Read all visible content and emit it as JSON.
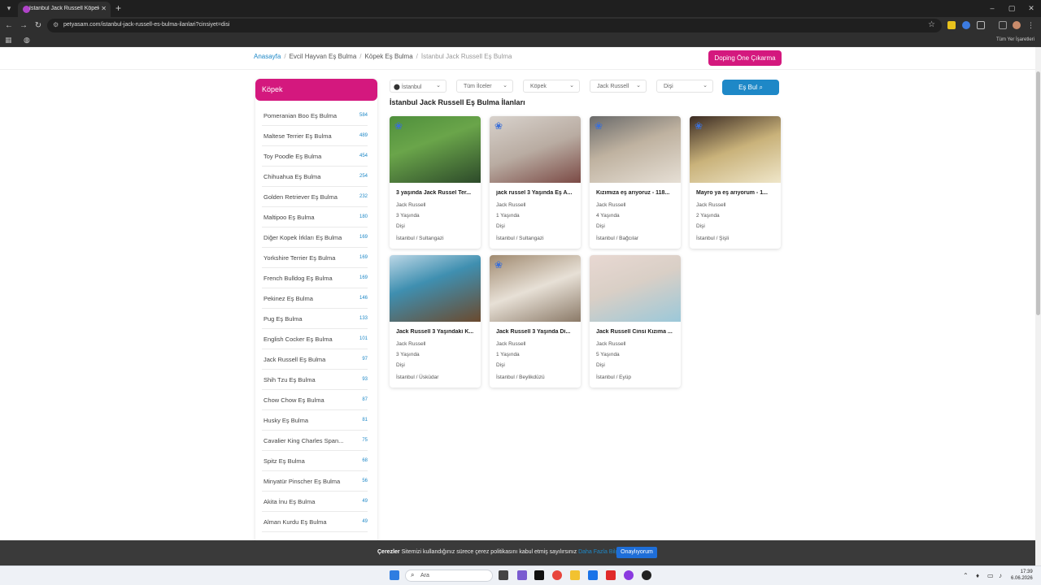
{
  "browser": {
    "tab_title": "İstanbul Jack Russell Köpek Eş Bulma",
    "url": "petyasam.com/istanbul-jack-russell-es-bulma-ilanlari?cinsiyet=disi",
    "bookmarks_all": "Tüm Yer İşaretleri",
    "window": {
      "minimize": "–",
      "maximize": "▢",
      "close": "✕"
    }
  },
  "breadcrumb": {
    "home": "Anasayfa",
    "pets": "Evcil Hayvan Eş Bulma",
    "dog": "Köpek Eş Bulma",
    "current": "İstanbul Jack Russell Eş Bulma",
    "sep": "/"
  },
  "doping_button": "Doping Öne Çıkarma",
  "sidebar": {
    "title": "Köpek",
    "items": [
      {
        "label": "Pomeranian Boo Eş Bulma",
        "count": "584"
      },
      {
        "label": "Maltese Terrier Eş Bulma",
        "count": "489"
      },
      {
        "label": "Toy Poodle Eş Bulma",
        "count": "454"
      },
      {
        "label": "Chihuahua Eş Bulma",
        "count": "254"
      },
      {
        "label": "Golden Retriever Eş Bulma",
        "count": "232"
      },
      {
        "label": "Maltipoo Eş Bulma",
        "count": "180"
      },
      {
        "label": "Diğer Kopek İrkları Eş Bulma",
        "count": "169"
      },
      {
        "label": "Yorkshire Terrier Eş Bulma",
        "count": "169"
      },
      {
        "label": "French Bulldog Eş Bulma",
        "count": "169"
      },
      {
        "label": "Pekinez Eş Bulma",
        "count": "146"
      },
      {
        "label": "Pug Eş Bulma",
        "count": "133"
      },
      {
        "label": "English Cocker Eş Bulma",
        "count": "101"
      },
      {
        "label": "Jack Russell Eş Bulma",
        "count": "97"
      },
      {
        "label": "Shih Tzu Eş Bulma",
        "count": "93"
      },
      {
        "label": "Chow Chow Eş Bulma",
        "count": "87"
      },
      {
        "label": "Husky Eş Bulma",
        "count": "81"
      },
      {
        "label": "Cavalier King Charles Span...",
        "count": "75"
      },
      {
        "label": "Spitz Eş Bulma",
        "count": "68"
      },
      {
        "label": "Minyatür Pinscher Eş Bulma",
        "count": "56"
      },
      {
        "label": "Akita İnu Eş Bulma",
        "count": "49"
      },
      {
        "label": "Alman Kurdu Eş Bulma",
        "count": "49"
      }
    ]
  },
  "filters": {
    "city": "İstanbul",
    "district": "Tüm İlceler",
    "species": "Köpek",
    "breed": "Jack Russell",
    "gender": "Dişi",
    "search_button": "Eş Bul"
  },
  "results_title": "İstanbul Jack Russell Eş Bulma İlanları",
  "listings": [
    {
      "title": "3 yaşında Jack Russel Ter...",
      "breed": "Jack Russell",
      "age": "3 Yaşında",
      "gender": "Dişi",
      "location": "İstanbul / Sultangazi",
      "paw": true
    },
    {
      "title": "jack russel 3 Yaşında Eş A...",
      "breed": "Jack Russell",
      "age": "1 Yaşında",
      "gender": "Dişi",
      "location": "İstanbul / Sultangazi",
      "paw": true
    },
    {
      "title": "Kızımıza eş arıyoruz - 118...",
      "breed": "Jack Russell",
      "age": "4 Yaşında",
      "gender": "Dişi",
      "location": "İstanbul / Bağcılar",
      "paw": true
    },
    {
      "title": "Mayro ya eş arıyorum - 1...",
      "breed": "Jack Russell",
      "age": "2 Yaşında",
      "gender": "Dişi",
      "location": "İstanbul / Şişli",
      "paw": true
    },
    {
      "title": "Jack Russell 3 Yaşındaki K...",
      "breed": "Jack Russell",
      "age": "3 Yaşında",
      "gender": "Dişi",
      "location": "İstanbul / Üsküdar",
      "paw": false
    },
    {
      "title": "Jack Russell 3 Yaşında Di...",
      "breed": "Jack Russell",
      "age": "1 Yaşında",
      "gender": "Dişi",
      "location": "İstanbul / Beylikdüzü",
      "paw": true
    },
    {
      "title": "Jack Russell Cinsi Kızıma ...",
      "breed": "Jack Russell",
      "age": "5 Yaşında",
      "gender": "Dişi",
      "location": "İstanbul / Eyüp",
      "paw": false
    }
  ],
  "cookie": {
    "label": "Çerezler",
    "text": "Sitemizi kullandığınız sürece çerez politikasını kabul etmiş sayılırsınız",
    "link": "Daha Fazla Bilgi",
    "button": "Onaylıyorum"
  },
  "taskbar": {
    "search_placeholder": "Ara",
    "time": "17:39",
    "date": "6.06.2026"
  },
  "colors": {
    "brand_pink": "#d4187e",
    "accent_blue": "#1e88c7"
  }
}
